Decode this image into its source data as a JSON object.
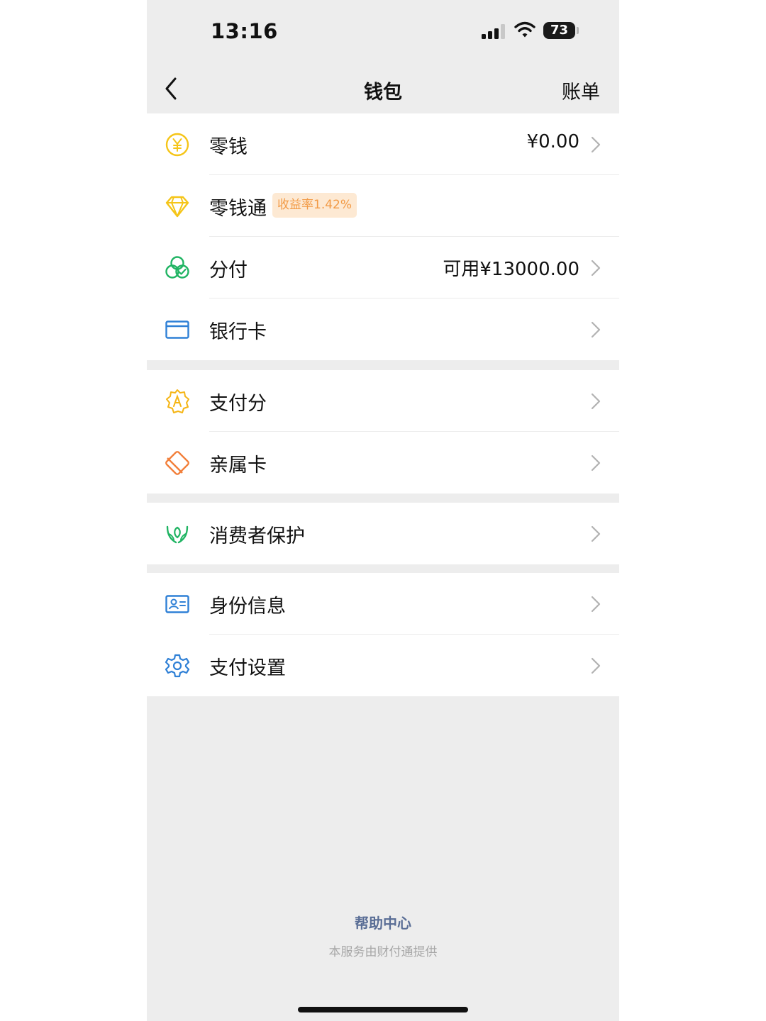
{
  "status_bar": {
    "time": "13:16",
    "battery": "73"
  },
  "nav": {
    "title": "钱包",
    "right_label": "账单"
  },
  "groups": [
    {
      "items": [
        {
          "label": "零钱",
          "value": "¥0.00",
          "icon": "coin-yuan-icon",
          "color": "#f5c518"
        },
        {
          "label": "零钱通",
          "badge": "收益率1.42%",
          "icon": "diamond-icon",
          "color": "#f5c518"
        },
        {
          "label": "分付",
          "value": "可用¥13000.00",
          "icon": "fenfu-icon",
          "color": "#20b463"
        },
        {
          "label": "银行卡",
          "icon": "bank-card-icon",
          "color": "#2f80d6"
        }
      ]
    },
    {
      "items": [
        {
          "label": "支付分",
          "icon": "pay-score-icon",
          "color": "#f5b515"
        },
        {
          "label": "亲属卡",
          "icon": "family-card-icon",
          "color": "#f27f3a"
        }
      ]
    },
    {
      "items": [
        {
          "label": "消费者保护",
          "icon": "consumer-protection-icon",
          "color": "#20b463"
        }
      ]
    },
    {
      "items": [
        {
          "label": "身份信息",
          "icon": "id-card-icon",
          "color": "#2f80d6"
        },
        {
          "label": "支付设置",
          "icon": "settings-gear-icon",
          "color": "#2f80d6"
        }
      ]
    }
  ],
  "footer": {
    "help_center": "帮助中心",
    "provider": "本服务由财付通提供"
  }
}
